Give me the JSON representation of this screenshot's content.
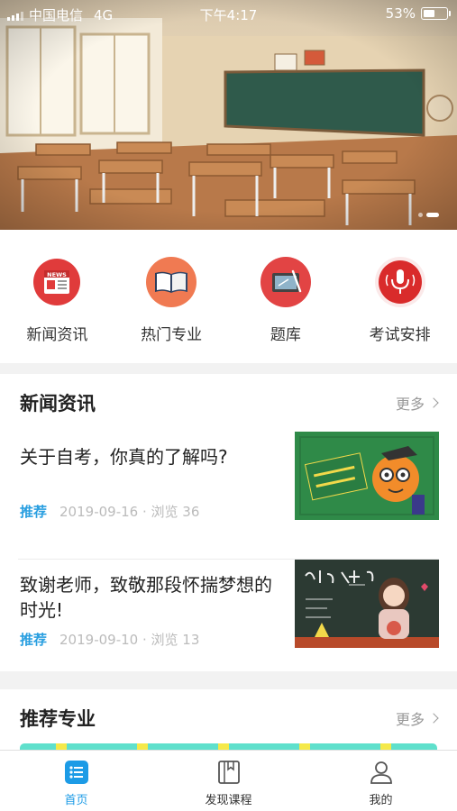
{
  "status_bar": {
    "carrier": "中国电信",
    "network": "4G",
    "time": "下午4:17",
    "battery": "53%",
    "battery_level": 0.53
  },
  "banner": {
    "slide_count": 2,
    "active_index": 1
  },
  "quick_menu": [
    {
      "label": "新闻资讯",
      "icon": "news-icon",
      "color": "#e03b3b"
    },
    {
      "label": "热门专业",
      "icon": "book-icon",
      "color": "#f07a52"
    },
    {
      "label": "题库",
      "icon": "tablet-pen-icon",
      "color": "#e24444"
    },
    {
      "label": "考试安排",
      "icon": "microphone-icon",
      "color": "#d92b2b"
    }
  ],
  "news_section": {
    "title": "新闻资讯",
    "more": "更多",
    "items": [
      {
        "title": "关于自考，你真的了解吗?",
        "tag": "推荐",
        "date": "2019-09-16",
        "views": "浏览 36"
      },
      {
        "title": "致谢老师，致敬那段怀揣梦想的时光!",
        "tag": "推荐",
        "date": "2019-09-10",
        "views": "浏览 13"
      }
    ]
  },
  "recommend_section": {
    "title": "推荐专业",
    "more": "更多"
  },
  "tabbar": [
    {
      "label": "首页",
      "icon": "home-list-icon",
      "active": true
    },
    {
      "label": "发现课程",
      "icon": "bookmark-book-icon",
      "active": false
    },
    {
      "label": "我的",
      "icon": "user-icon",
      "active": false
    }
  ],
  "colors": {
    "accent": "#1c9be6",
    "tag": "#2a9fe0"
  }
}
